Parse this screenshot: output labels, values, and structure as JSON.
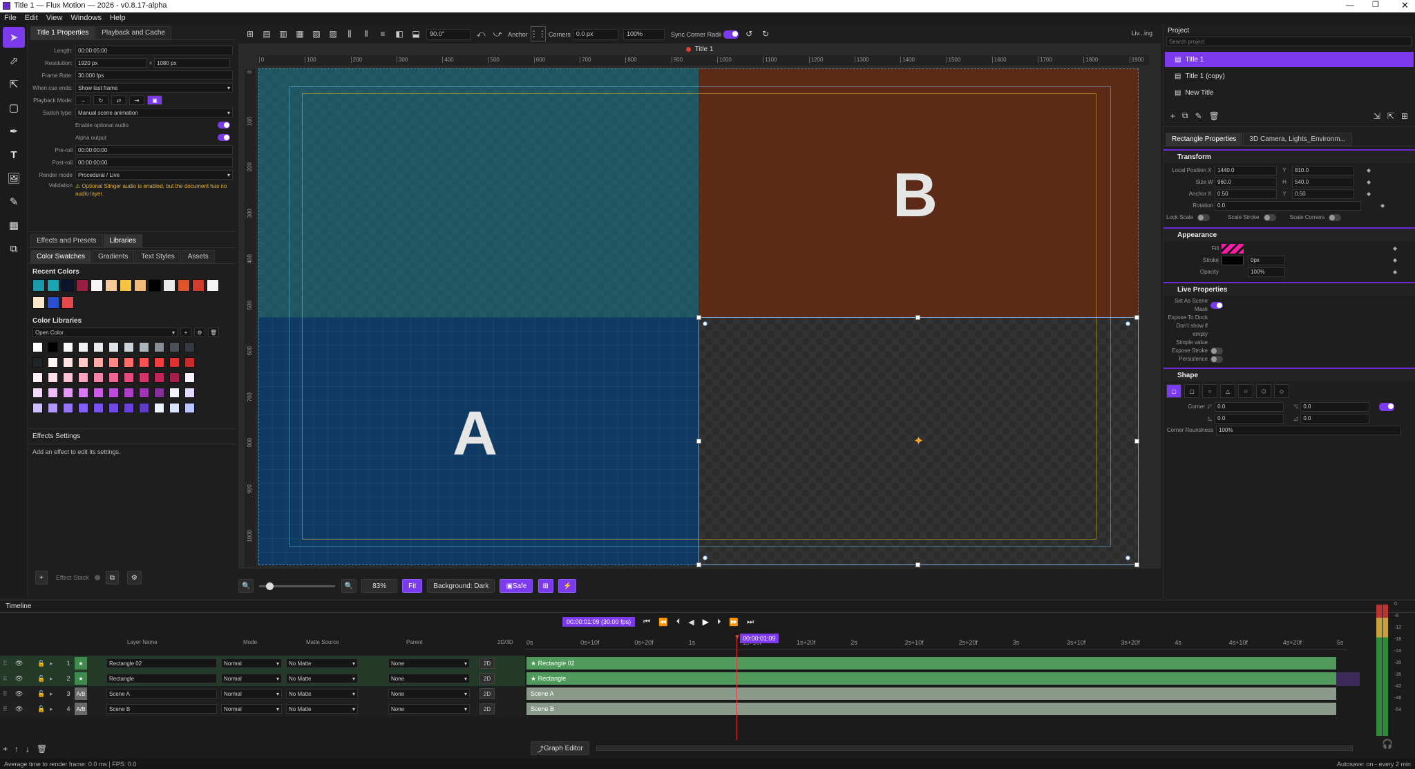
{
  "window": {
    "title": "Title 1 — Flux Motion — 2026 - v0.8.17-alpha"
  },
  "menu": [
    "File",
    "Edit",
    "View",
    "Windows",
    "Help"
  ],
  "left_tabs": {
    "tab1": "Title 1 Properties",
    "tab2": "Playback and Cache"
  },
  "props": {
    "length_label": "Length:",
    "length": "00:00:05:00",
    "resolution_label": "Resolution:",
    "res_w": "1920 px",
    "res_x": "×",
    "res_h": "1080 px",
    "framerate_label": "Frame Rate:",
    "framerate": "30.000 fps",
    "cue_label": "When cue ends:",
    "cue": "Show last frame",
    "playback_label": "Playback Mode:",
    "switch_label": "Switch type:",
    "switch": "Manual scene animation",
    "audio_label": "Enable optional audio",
    "alpha_label": "Alpha output",
    "preroll_label": "Pre-roll",
    "preroll": "00:00:00:00",
    "postroll_label": "Post-roll",
    "postroll": "00:00:00:00",
    "render_label": "Render mode",
    "render": "Procedural / Live",
    "validation_label": "Validation",
    "validation": "⚠ Optional Slinger audio is enabled, but the document has no audio layer."
  },
  "effects_tabs": {
    "tab1": "Effects and Presets",
    "tab2": "Libraries"
  },
  "lib_tabs": {
    "t1": "Color Swatches",
    "t2": "Gradients",
    "t3": "Text Styles",
    "t4": "Assets"
  },
  "recent_colors_title": "Recent Colors",
  "recent_colors": [
    "#1a9aaa",
    "#1aa4b4",
    "#0c1430",
    "#9a1e44",
    "#f5f5f5",
    "#f7c89a",
    "#f5c542",
    "#f5b97a",
    "#000000",
    "#eaeaea",
    "#e0542a",
    "#d33b2c",
    "#f5f5f5",
    "#f7e7c8",
    "#2a4fcf",
    "#e5484d"
  ],
  "color_libraries_title": "Color Libraries",
  "library_select": "Open Color",
  "library_colors": [
    [
      "#ffffff",
      "#000000",
      "#f8f9fa",
      "#f1f3f5",
      "#e9ecef",
      "#dee2e6",
      "#ced4da",
      "#adb5bd",
      "#868e96",
      "#495057",
      "#343a40"
    ],
    [
      "#212529",
      "#fff5f5",
      "#ffe3e3",
      "#ffc9c9",
      "#ffa8a8",
      "#ff8787",
      "#ff6b6b",
      "#fa5252",
      "#f03e3e",
      "#e03131",
      "#c92a2a"
    ],
    [
      "#fff0f6",
      "#ffdeeb",
      "#fcc2d7",
      "#faa2c1",
      "#f783ac",
      "#f06595",
      "#e64980",
      "#d6336c",
      "#c2255c",
      "#a61e4d",
      "#f8f0fc"
    ],
    [
      "#f3d9fa",
      "#eebefa",
      "#e599f7",
      "#da77f2",
      "#cc5de8",
      "#be4bdb",
      "#ae3ec9",
      "#9c36b5",
      "#862e9c",
      "#f3f0ff",
      "#e5dbff"
    ],
    [
      "#d0bfff",
      "#b197fc",
      "#9775fa",
      "#845ef7",
      "#7950f2",
      "#7048e8",
      "#6741d9",
      "#5f3dc4",
      "#edf2ff",
      "#dbe4ff",
      "#bac8ff"
    ]
  ],
  "effects_settings": {
    "title": "Effects Settings",
    "hint": "Add an effect to edit its settings.",
    "stack": "Effect Stack"
  },
  "toolbar": {
    "rotation": "90.0°",
    "anchor": "Anchor",
    "corners": "Corners",
    "corners_val": "0.0 px",
    "pct": "100%",
    "sync": "Sync Corner Radii",
    "right": "Liv...ing"
  },
  "doc_title": "Title 1",
  "ruler_h": [
    "0",
    "100",
    "200",
    "300",
    "400",
    "500",
    "600",
    "700",
    "800",
    "900",
    "1000",
    "1100",
    "1200",
    "1300",
    "1400",
    "1500",
    "1600",
    "1700",
    "1800",
    "1900"
  ],
  "ruler_v": [
    "0",
    "100",
    "200",
    "300",
    "400",
    "500",
    "600",
    "700",
    "800",
    "900",
    "1000"
  ],
  "scenes": {
    "a": "A",
    "b": "B"
  },
  "bottom": {
    "zoom": "83%",
    "fit": "Fit",
    "background": "Background: Dark",
    "safe": "Safe"
  },
  "project": {
    "title": "Project",
    "search": "Search project",
    "items": [
      "Title 1",
      "Title 1 (copy)",
      "New Title"
    ]
  },
  "rp_tabs": {
    "t1": "Rectangle Properties",
    "t2": "3D Camera, Lights_Environm..."
  },
  "transform": {
    "title": "Transform",
    "localpos": "Local Position",
    "x": "X",
    "y": "Y",
    "pos_x": "1440.0",
    "pos_y": "810.0",
    "size": "Size",
    "w": "W",
    "h": "H",
    "size_w": "960.0",
    "size_h": "540.0",
    "anchor": "Anchor",
    "anchor_x": "0.50",
    "anchor_y": "0.50",
    "rotation": "Rotation",
    "rotation_val": "0.0",
    "lockscale": "Lock Scale",
    "scalestroke": "Scale Stroke",
    "scalecorners": "Scale Corners"
  },
  "appearance": {
    "title": "Appearance",
    "fill": "Fill",
    "stroke": "Stroke",
    "stroke_val": "0px",
    "opacity": "Opacity",
    "opacity_val": "100%"
  },
  "live": {
    "title": "Live Properties",
    "mask": "Set As Scene Mask",
    "expose": "Expose To Dock",
    "dontshow": "Don't show if empty",
    "simple": "Simple value",
    "exposestroke": "Expose Stroke",
    "persistence": "Persistence"
  },
  "shape": {
    "title": "Shape",
    "corner": "Corner",
    "c1": "0.0",
    "c2": "0.0",
    "c3": "0.0",
    "c4": "0.0",
    "roundness": "Corner Roundness",
    "roundness_val": "100%"
  },
  "timeline": {
    "title": "Timeline",
    "timecode": "00:00:01:09  (30.00 fps)",
    "playhead": "00:00:01:09",
    "cols": {
      "name": "Layer Name",
      "mode": "Mode",
      "matte": "Matte Source",
      "parent": "Parent",
      "dim": "2D/3D"
    },
    "ruler": [
      "0s",
      "0s+10f",
      "0s+20f",
      "1s",
      "1s+10f",
      "1s+20f",
      "2s",
      "2s+10f",
      "2s+20f",
      "3s",
      "3s+10f",
      "3s+20f",
      "4s",
      "4s+10f",
      "4s+20f",
      "5s"
    ],
    "layers": [
      {
        "num": "1",
        "badge": "★",
        "name": "Rectangle 02",
        "mode": "Normal",
        "matte": "No Matte",
        "parent": "None",
        "dim": "2D",
        "clip": "★ Rectangle 02"
      },
      {
        "num": "2",
        "badge": "★",
        "name": "Rectangle",
        "mode": "Normal",
        "matte": "No Matte",
        "parent": "None",
        "dim": "2D",
        "clip": "★ Rectangle"
      },
      {
        "num": "3",
        "badge": "A/B",
        "name": "Scene A",
        "mode": "Normal",
        "matte": "No Matte",
        "parent": "None",
        "dim": "2D",
        "clip": "Scene A"
      },
      {
        "num": "4",
        "badge": "A/B",
        "name": "Scene B",
        "mode": "Normal",
        "matte": "No Matte",
        "parent": "None",
        "dim": "2D",
        "clip": "Scene B"
      }
    ],
    "graph_editor": "Graph Editor",
    "meter": [
      "0",
      "-6",
      "-12",
      "-18",
      "-24",
      "-30",
      "-36",
      "-42",
      "-48",
      "-54"
    ]
  },
  "status": {
    "left": "Average time to render frame: 0.0 ms | FPS: 0.0",
    "right": "Autosave: on - every 2 min"
  }
}
